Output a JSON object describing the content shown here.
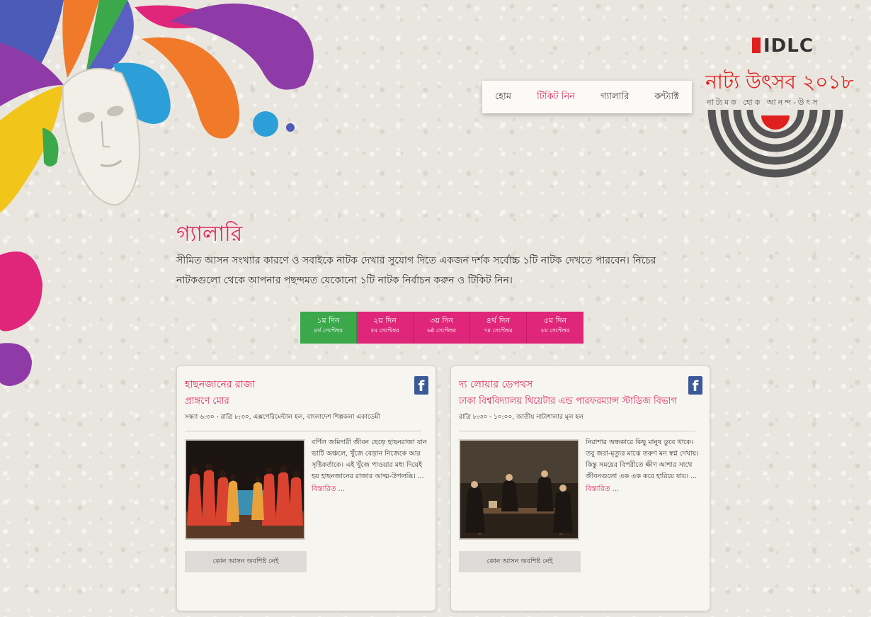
{
  "nav": {
    "items": [
      {
        "label": "হোম",
        "active": false
      },
      {
        "label": "টিকিট নিন",
        "active": true
      },
      {
        "label": "গ্যালারি",
        "active": false
      },
      {
        "label": "কন্ট্যাক্ট",
        "active": false
      }
    ]
  },
  "logo": {
    "brand": "IDLC",
    "title": "নাট্য উৎসব ২০১৮",
    "subtitle": "নাট্যমক হোক আনন্দ-উৎস"
  },
  "gallery": {
    "heading": "গ্যালারি",
    "intro": "সীমিত আসন সংখ্যার কারণে ও সবাইকে নাটক দেখার সুযোগ দিতে একজন দর্শক সর্বোচ্চ ১টি নাটক দেখতে পারবেন। নিচের নাটকগুলো থেকে আপনার পছন্দমত যেকোনো ১টি নাটক নির্বাচন করুন ও টিকিট নিন।"
  },
  "tabs": [
    {
      "day": "১ম দিন",
      "date": "৪র্থ সেপ্টেম্বর",
      "active": true
    },
    {
      "day": "২য় দিন",
      "date": "৫ম সেপ্টেম্বর",
      "active": false
    },
    {
      "day": "৩য় দিন",
      "date": "৬ষ্ঠ সেপ্টেম্বর",
      "active": false
    },
    {
      "day": "৪র্থ দিন",
      "date": "৭ম সেপ্টেম্বর",
      "active": false
    },
    {
      "day": "৫ম দিন",
      "date": "৮ম সেপ্টেম্বর",
      "active": false
    }
  ],
  "cards": [
    {
      "title": "হাছনজানের রাজা",
      "troupe": "প্রাঙ্গণে মোর",
      "time": "সন্ধ্যা ৬:৩০ - রাত্রি ৮:৩০, এক্সপেরিমেন্টাল হল, বাংলাদেশ শিল্পকলা একাডেমী",
      "description": "বর্ণিল জমিদারী জীবন ছেড়ে হাছনরাজা যান ভাটি অঞ্চলে, খুঁজে বেড়ান নিজেকে আর সৃষ্টিকর্তাকে। এই খুঁজে পাওয়ার মধ্য দিয়েই হয় হাছনজানের রাজার আত্ম-উপলব্ধি। ...",
      "more": "বিস্তারিত ...",
      "seat": "কোন আসন অবশিষ্ট নেই",
      "fb": "f"
    },
    {
      "title": "দ্য লোয়ার ডেপথস",
      "troupe": "ঢাকা বিশ্ববিদ্যালয় থিয়েটার এন্ড পারফরম্যান্স স্টাডিজ বিভাগ",
      "time": "রাত্রি ৮:৩০ - ১০:০০, জাতীয় নাট্যশালার মূল হল",
      "description": "নিরাশার অন্ধকারে কিছু মানুষ ডুবে থাকে। তবু জরা-মৃত্যুর মাঝে তরুণ মন স্বপ্ন দেখায়। কিন্তু সময়ের বিপরীতে ক্ষীণ আশার সাথে জীবনগুলো এক এক করে হারিয়ে যায়। ...",
      "more": "বিস্তারিত ...",
      "seat": "কোন আসন অবশিষ্ট নেই",
      "fb": "f"
    }
  ]
}
